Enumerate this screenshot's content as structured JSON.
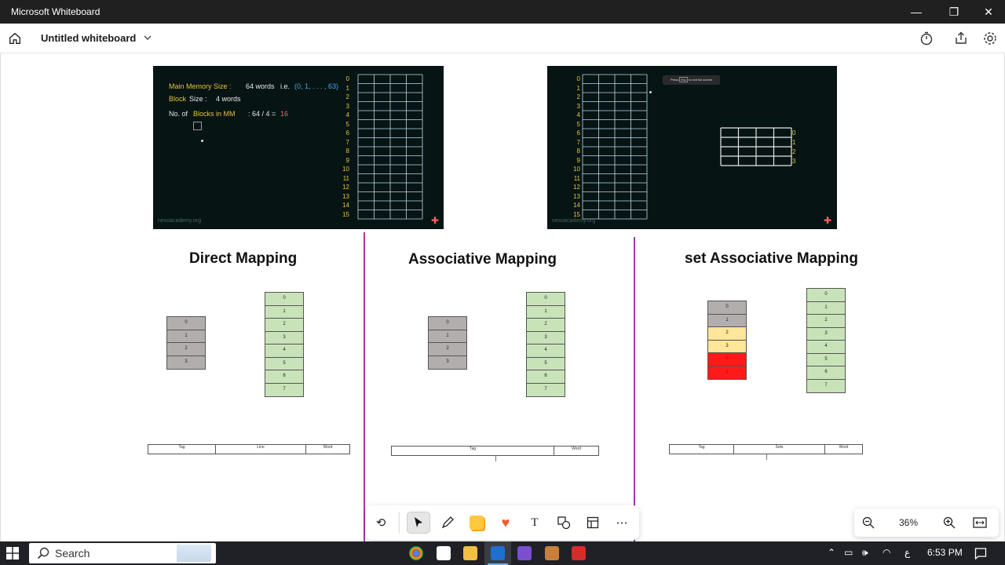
{
  "window": {
    "title": "Microsoft Whiteboard",
    "minimize": "—",
    "maximize": "❐",
    "close": "✕"
  },
  "appbar": {
    "doc_title": "Untitled whiteboard"
  },
  "slide1": {
    "line1_label": "Main Memory Size :",
    "line1_value": "64 words",
    "line1_ie": "i.e.",
    "line1_range": "(0, 1, . . . , 63)",
    "line2_label": "Block",
    "line2_label2": "Size :",
    "line2_value": "4 words",
    "line3_prefix": "No. of",
    "line3_blocks": "Blocks in MM",
    "line3_expr": ": 64 / 4 =",
    "line3_result": "16",
    "watermark": "nesoacademy.org",
    "row_numbers": [
      "0",
      "1",
      "2",
      "3",
      "4",
      "5",
      "6",
      "7",
      "8",
      "9",
      "10",
      "11",
      "12",
      "13",
      "14",
      "15"
    ]
  },
  "slide2": {
    "watermark": "nesoacademy.org",
    "row_numbers": [
      "0",
      "1",
      "2",
      "3",
      "4",
      "5",
      "6",
      "7",
      "8",
      "9",
      "10",
      "11",
      "12",
      "13",
      "14",
      "15"
    ],
    "cache_rows": [
      "0",
      "1",
      "2",
      "3"
    ],
    "fullscreen_hint_press": "Press",
    "fullscreen_hint_key": "Esc",
    "fullscreen_hint_rest": "to exit full screen"
  },
  "sections": [
    {
      "heading": "Direct Mapping",
      "cache": [
        "0",
        "1",
        "2",
        "3"
      ],
      "memory": [
        "0",
        "1",
        "2",
        "3",
        "4",
        "5",
        "6",
        "7"
      ],
      "addr": [
        "Tag",
        "Line",
        "Word"
      ]
    },
    {
      "heading": "Associative Mapping",
      "cache": [
        "0",
        "1",
        "2",
        "3"
      ],
      "memory": [
        "0",
        "1",
        "2",
        "3",
        "4",
        "5",
        "6",
        "7"
      ],
      "addr": [
        "Tag",
        "Word"
      ]
    },
    {
      "heading": "set Associative Mapping",
      "cache": [
        "0",
        "1",
        "2",
        "3",
        "0",
        "1"
      ],
      "memory": [
        "0",
        "1",
        "2",
        "3",
        "4",
        "5",
        "6",
        "7"
      ],
      "addr": [
        "Tag",
        "Sets",
        "Word"
      ]
    }
  ],
  "colors": {
    "grey_block": "#b3aeae",
    "green_block": "#c9e3b9",
    "yellow_block": "#ffe699",
    "red_block": "#ff1a1a",
    "divider": "#a23aa3"
  },
  "toolbar": {
    "icons": [
      "undo-icon",
      "select-icon",
      "pen-icon",
      "sticky-note-icon",
      "reactions-icon",
      "text-icon",
      "shapes-icon",
      "templates-icon",
      "more-icon"
    ]
  },
  "zoom": {
    "level": "36%"
  },
  "taskbar": {
    "search_label": "Search",
    "time": "6:53 PM",
    "lang": "ع"
  }
}
